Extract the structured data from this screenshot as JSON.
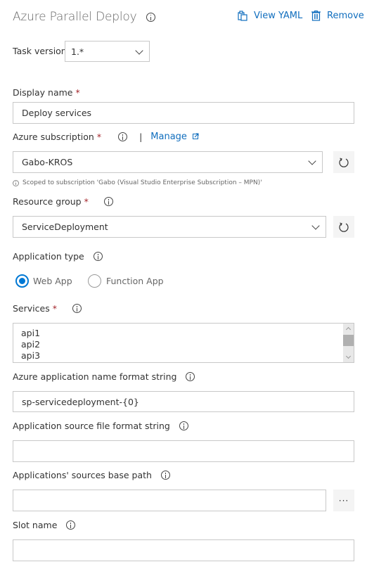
{
  "header": {
    "title": "Azure Parallel Deploy",
    "view_yaml": "View YAML",
    "remove": "Remove"
  },
  "task_version": {
    "label": "Task version",
    "value": "1.*"
  },
  "display_name": {
    "label": "Display name",
    "required": "*",
    "value": "Deploy services"
  },
  "azure_subscription": {
    "label": "Azure subscription",
    "required": "*",
    "separator": "|",
    "manage": "Manage",
    "value": "Gabo-KROS",
    "hint": "Scoped to subscription 'Gabo (Visual Studio Enterprise Subscription – MPN)'"
  },
  "resource_group": {
    "label": "Resource group",
    "required": "*",
    "value": "ServiceDeployment"
  },
  "application_type": {
    "label": "Application type",
    "options": [
      {
        "label": "Web App",
        "selected": true
      },
      {
        "label": "Function App",
        "selected": false
      }
    ]
  },
  "services": {
    "label": "Services",
    "required": "*",
    "items": [
      "api1",
      "api2",
      "api3"
    ]
  },
  "app_name_format": {
    "label": "Azure application name format string",
    "value": "sp-servicedeployment-{0}"
  },
  "app_source_format": {
    "label": "Application source file format string",
    "value": ""
  },
  "sources_base_path": {
    "label": "Applications' sources base path",
    "value": "",
    "browse": "···"
  },
  "slot_name": {
    "label": "Slot name",
    "value": ""
  },
  "colors": {
    "accent": "#0078d4",
    "link": "#106ebe",
    "required": "#a4262c"
  }
}
